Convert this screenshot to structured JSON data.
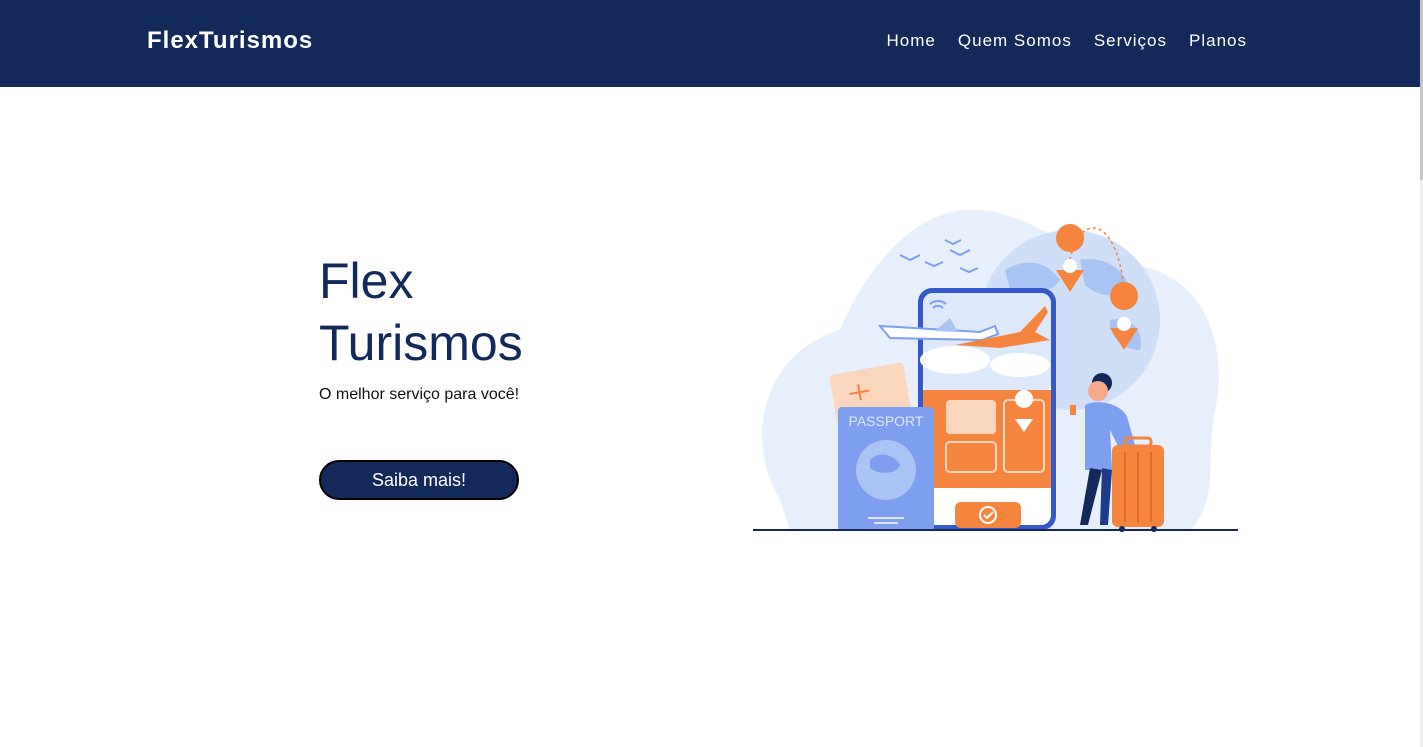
{
  "header": {
    "brand": "FlexTurismos",
    "nav": [
      {
        "label": "Home"
      },
      {
        "label": "Quem Somos"
      },
      {
        "label": "Serviços"
      },
      {
        "label": "Planos"
      }
    ]
  },
  "hero": {
    "title_line1": "Flex",
    "title_line2": "Turismos",
    "subtitle": "O melhor serviço para você!",
    "cta_label": "Saiba mais!"
  },
  "illustration": {
    "passport_label": "PASSPORT",
    "icons": [
      "airplane-icon",
      "location-pin-icon",
      "wifi-icon",
      "suitcase-icon",
      "check-icon"
    ]
  },
  "colors": {
    "navbar": "#12295a",
    "accent_orange": "#f5843e",
    "light_blue": "#dde9fb",
    "mid_blue": "#7e9ef0"
  }
}
